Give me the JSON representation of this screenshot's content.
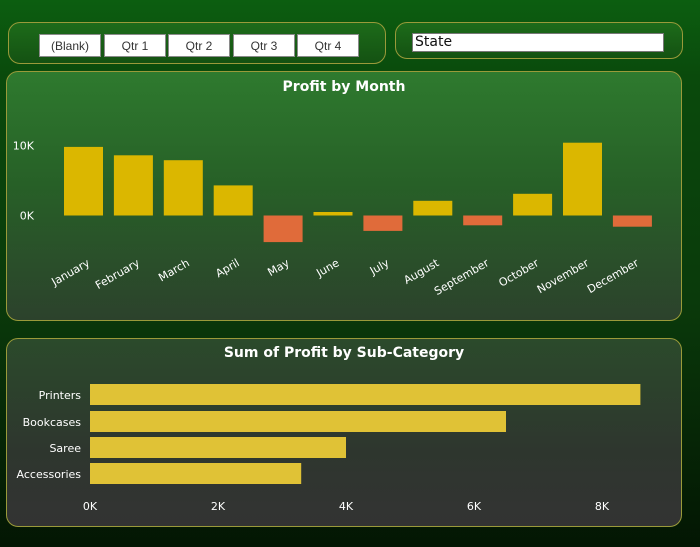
{
  "quarter_slicer": {
    "options": [
      "(Blank)",
      "Qtr 1",
      "Qtr 2",
      "Qtr 3",
      "Qtr 4"
    ]
  },
  "state_slicer": {
    "value": "State"
  },
  "colors": {
    "positive": "#dbb700",
    "negative": "#e06b3a",
    "subcat_bar": "#e0c236"
  },
  "chart_data": [
    {
      "type": "bar",
      "title": "Profit by Month",
      "categories": [
        "January",
        "February",
        "March",
        "April",
        "May",
        "June",
        "July",
        "August",
        "September",
        "October",
        "November",
        "December"
      ],
      "values": [
        9800,
        8600,
        7900,
        4300,
        -3800,
        500,
        -2200,
        2100,
        -1400,
        3100,
        10400,
        -1600
      ],
      "y_ticks": [
        {
          "value": 10000,
          "label": "10K"
        },
        {
          "value": 0,
          "label": "0K"
        }
      ],
      "ylim": [
        -4000,
        12000
      ],
      "grid": false
    },
    {
      "type": "bar",
      "orientation": "horizontal",
      "title": "Sum of Profit by Sub-Category",
      "categories": [
        "Printers",
        "Bookcases",
        "Saree",
        "Accessories"
      ],
      "values": [
        8600,
        6500,
        4000,
        3300
      ],
      "x_ticks": [
        {
          "value": 0,
          "label": "0K"
        },
        {
          "value": 2000,
          "label": "2K"
        },
        {
          "value": 4000,
          "label": "4K"
        },
        {
          "value": 6000,
          "label": "6K"
        },
        {
          "value": 8000,
          "label": "8K"
        }
      ],
      "xlim": [
        0,
        9000
      ],
      "grid": false
    }
  ]
}
